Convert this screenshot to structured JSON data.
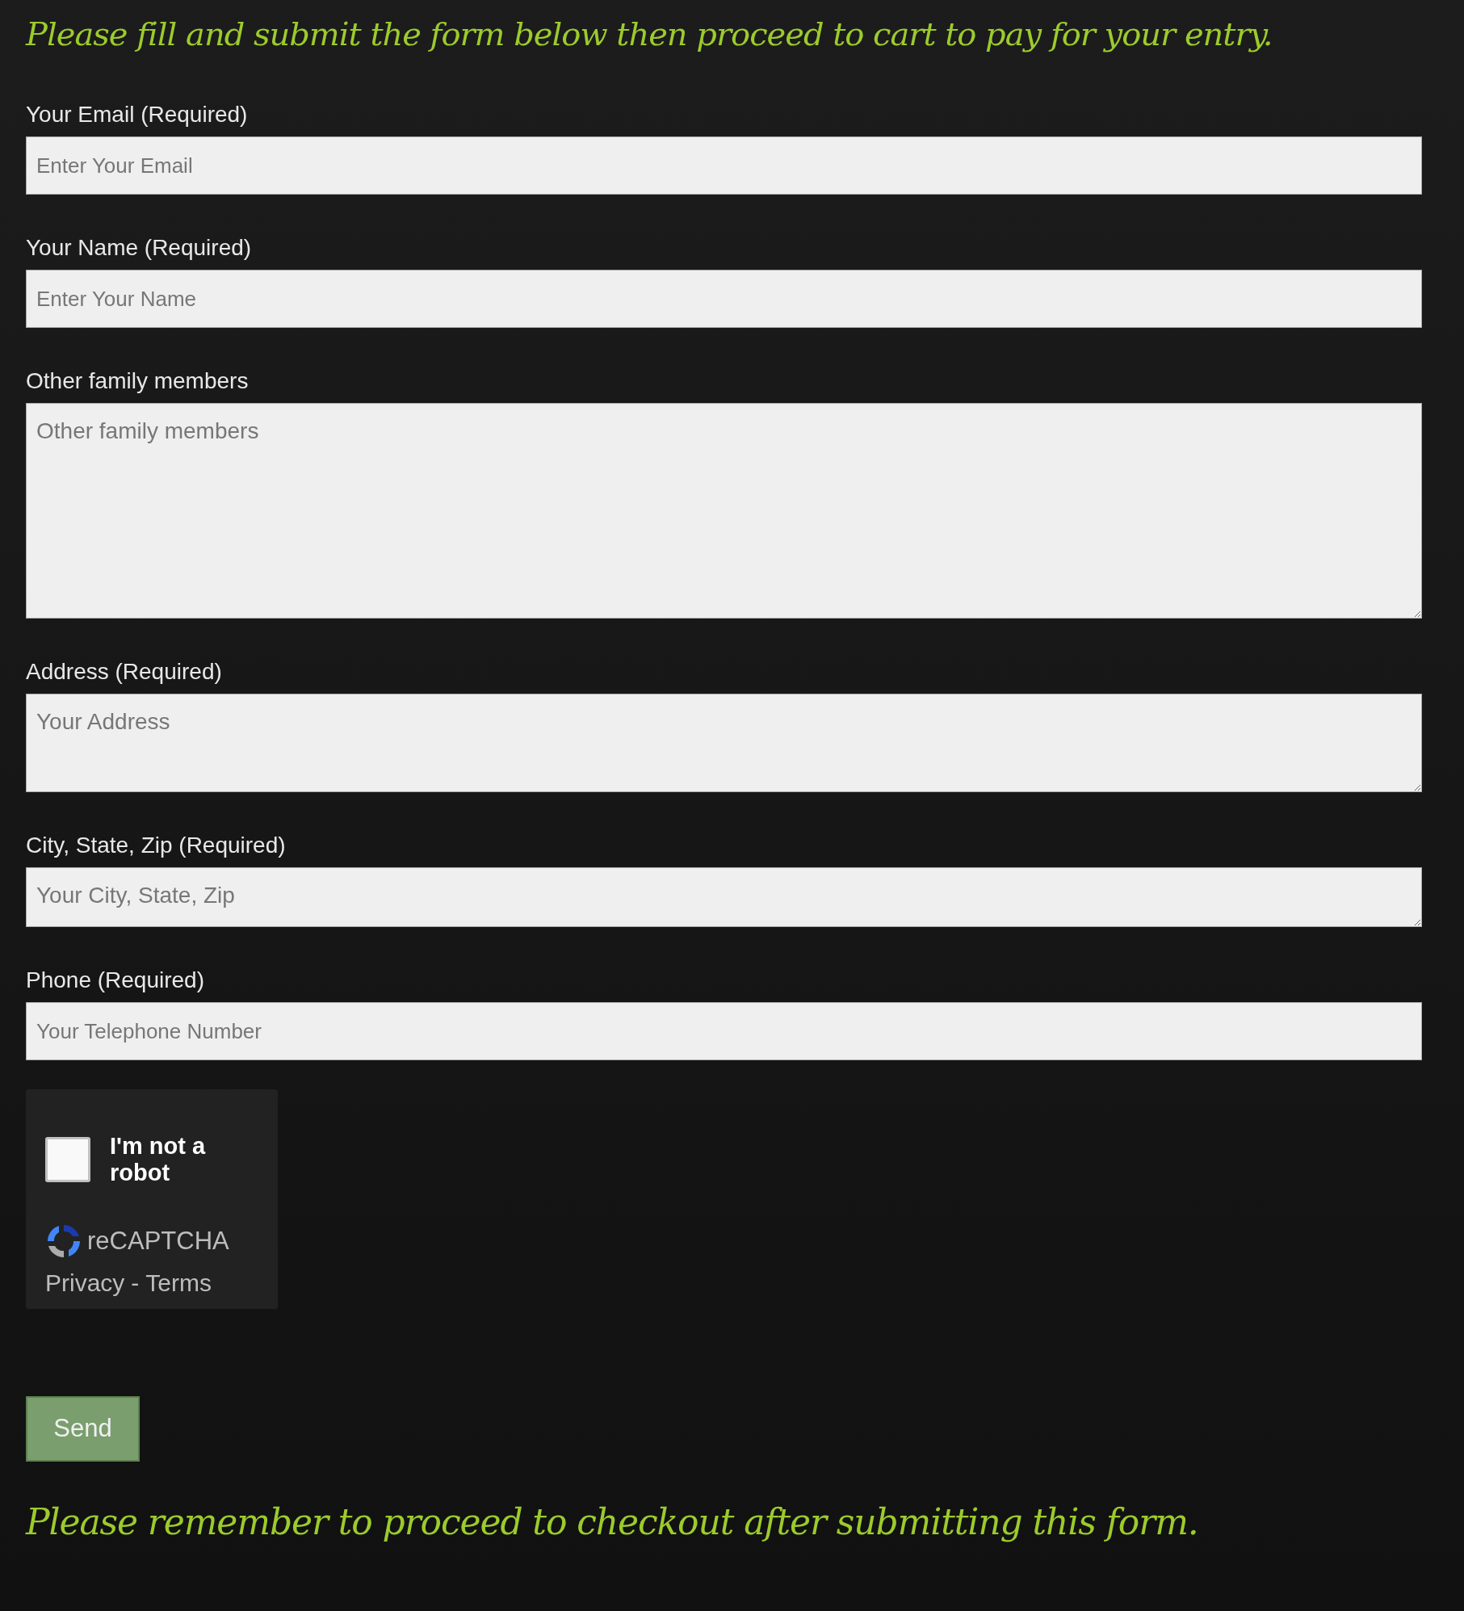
{
  "heading": "Please fill and submit the form below then proceed to cart to pay for your entry.",
  "fields": [
    {
      "kind": "input",
      "label": "Your Email (Required)",
      "placeholder": "Enter Your Email"
    },
    {
      "kind": "input",
      "label": "Your Name (Required)",
      "placeholder": "Enter Your Name"
    },
    {
      "kind": "textarea-large",
      "label": "Other family members",
      "placeholder": "Other family members"
    },
    {
      "kind": "textarea-medium",
      "label": "Address (Required)",
      "placeholder": "Your Address"
    },
    {
      "kind": "textarea-small",
      "label": "City, State, Zip (Required)",
      "placeholder": "Your City, State, Zip"
    },
    {
      "kind": "input",
      "label": "Phone (Required)",
      "placeholder": "Your Telephone Number"
    }
  ],
  "captcha": {
    "checked": false,
    "label": "I'm not a robot",
    "brand": "reCAPTCHA",
    "links": [
      "Privacy",
      "Terms"
    ],
    "separator": "-"
  },
  "submit": "Send",
  "footer_note": "Please remember to proceed to checkout after submitting this form."
}
